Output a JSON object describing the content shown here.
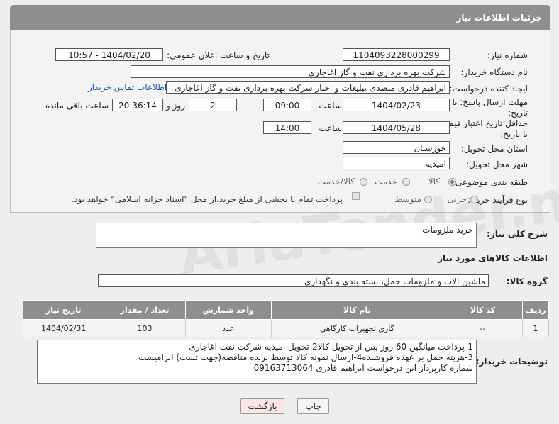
{
  "header": {
    "title": "جزئیات اطلاعات نیاز"
  },
  "form": {
    "need_number_label": "شماره نیاز:",
    "need_number": "1104093228000299",
    "announce_label": "تاریخ و ساعت اعلان عمومی:",
    "announce_value": "1404/02/20 - 10:57",
    "buyer_org_label": "نام دستگاه خریدار:",
    "buyer_org": "شرکت بهره برداری نفت و گاز اغاجاری",
    "creator_label": "ایجاد کننده درخواست:",
    "creator": "ابراهیم قادری متصدی تبلیغات و اخبار شرکت بهره برداری نفت و گاز اغاجاری",
    "contact_link": "اطلاعات تماس خریدار",
    "deadline_label_1": "مهلت ارسال پاسخ: تا",
    "deadline_label_2": "تاریخ:",
    "deadline_date": "1404/02/23",
    "time_label": "ساعت",
    "deadline_time": "09:00",
    "days_value": "2",
    "days_label": "روز و",
    "remaining_value": "20:36:14",
    "remaining_label": "ساعت باقی مانده",
    "validity_label_1": "حداقل تاریخ اعتبار قیمت:",
    "validity_label_2": "تا تاریخ:",
    "validity_date": "1404/05/28",
    "validity_time": "14:00",
    "province_label": "استان محل تحویل:",
    "province": "خوزستان",
    "city_label": "شهر محل تحویل:",
    "city": "امیدیه",
    "category_label": "طبقه بندی موضوعی:",
    "category_options": [
      "کالا",
      "خدمت",
      "کالا/خدمت"
    ],
    "process_label": "نوع فرآیند خرید :",
    "process_options": [
      "جزیی",
      "متوسط"
    ],
    "payment_note": "پرداخت تمام یا بخشی از مبلغ خرید،از محل \"اسناد خزانه اسلامی\" خواهد بود."
  },
  "description": {
    "label": "شرح کلی نیاز:",
    "value": "خرید ملزومات"
  },
  "goods": {
    "section_title": "اطلاعات کالاهای مورد نیاز",
    "group_label": "گروه کالا:",
    "group_value": "ماشین آلات و ملزومات حمل، بسته بندی و نگهداری",
    "columns": [
      "ردیف",
      "کد کالا",
      "نام کالا",
      "واحد شمارش",
      "تعداد / مقدار",
      "تاریخ نیاز"
    ],
    "rows": [
      {
        "index": "1",
        "code": "--",
        "name": "گاری تجهیزات کارگاهی",
        "unit": "عدد",
        "qty": "103",
        "date": "1404/02/31"
      }
    ]
  },
  "buyer_notes": {
    "label": "توضیحات خریدار:",
    "line1": "1-پرداخت میانگین 60 روز پس از تحویل کالا2-تحویل امیدیه شرکت نفت آغاجاری",
    "line2": "3-هزینه حمل بر عهده فروشنده4-ارسال نمونه کالا توسط برنده مناقصه(جهت تست) الزامیست",
    "line3": "شماره کارپرداز این درخواست  ابراهیم قادری 09163713064"
  },
  "buttons": {
    "print": "چاپ",
    "back": "بازگشت"
  },
  "watermark": "AriaTender.neT"
}
